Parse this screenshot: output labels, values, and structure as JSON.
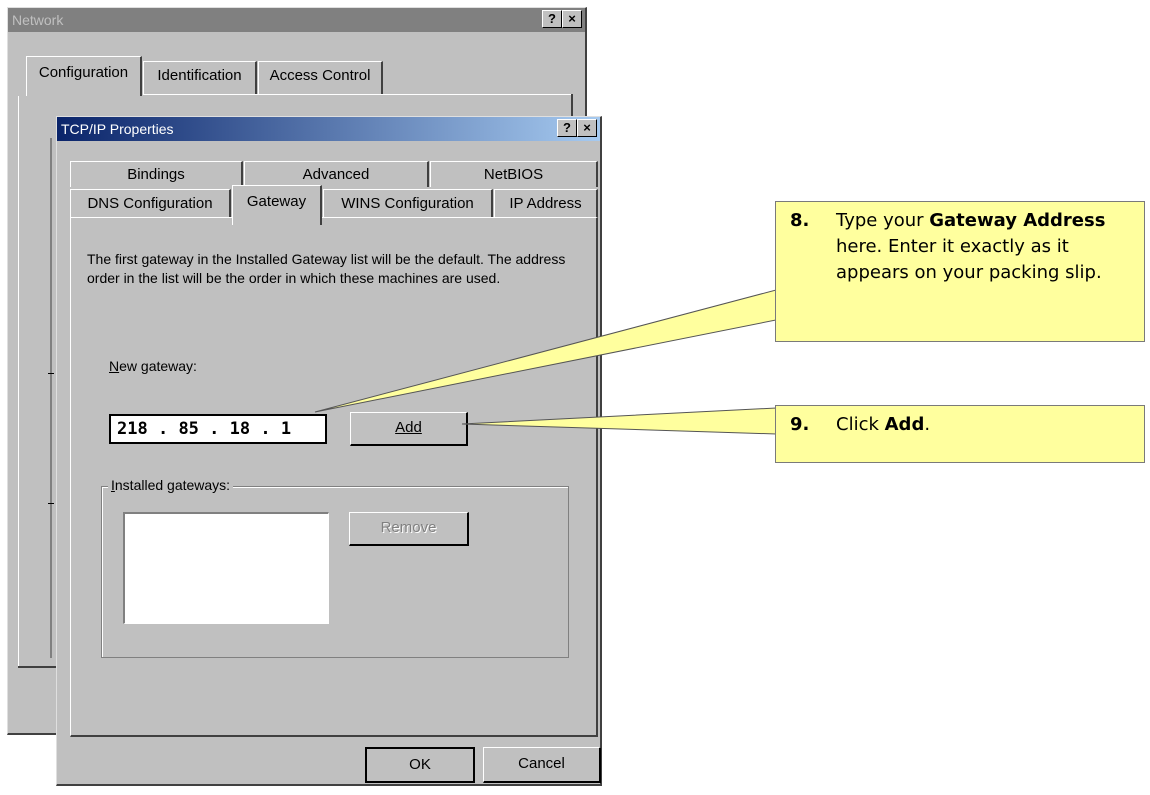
{
  "network_window": {
    "title": "Network",
    "tabs": [
      "Configuration",
      "Identification",
      "Access Control"
    ]
  },
  "tcpip_window": {
    "title": "TCP/IP Properties",
    "tabs_row1": [
      "Bindings",
      "Advanced",
      "NetBIOS"
    ],
    "tabs_row2": [
      "DNS Configuration",
      "Gateway",
      "WINS Configuration",
      "IP Address"
    ],
    "description": "The first gateway in the Installed Gateway list will be the default. The address order in the list will be the order in which these machines are used.",
    "new_gateway_label": "New gateway:",
    "gateway_octets": [
      "218",
      "85",
      "18",
      "1"
    ],
    "add_button": "Add",
    "installed_label": "Installed gateways:",
    "remove_button": "Remove",
    "ok_button": "OK",
    "cancel_button": "Cancel"
  },
  "title_buttons": {
    "help": "?",
    "close": "×"
  },
  "callouts": [
    {
      "number": "8.",
      "pre": "Type your ",
      "bold": "Gateway Address",
      "post": " here. Enter it exactly as it appears on your packing slip."
    },
    {
      "number": "9.",
      "pre": "Click ",
      "bold": "Add",
      "post": "."
    }
  ],
  "colors": {
    "title_active_start": "#0a246a",
    "title_active_end": "#a6caf0",
    "title_inactive": "#808080",
    "dialog_face": "#c0c0c0",
    "callout_fill": "#ffff9e"
  }
}
